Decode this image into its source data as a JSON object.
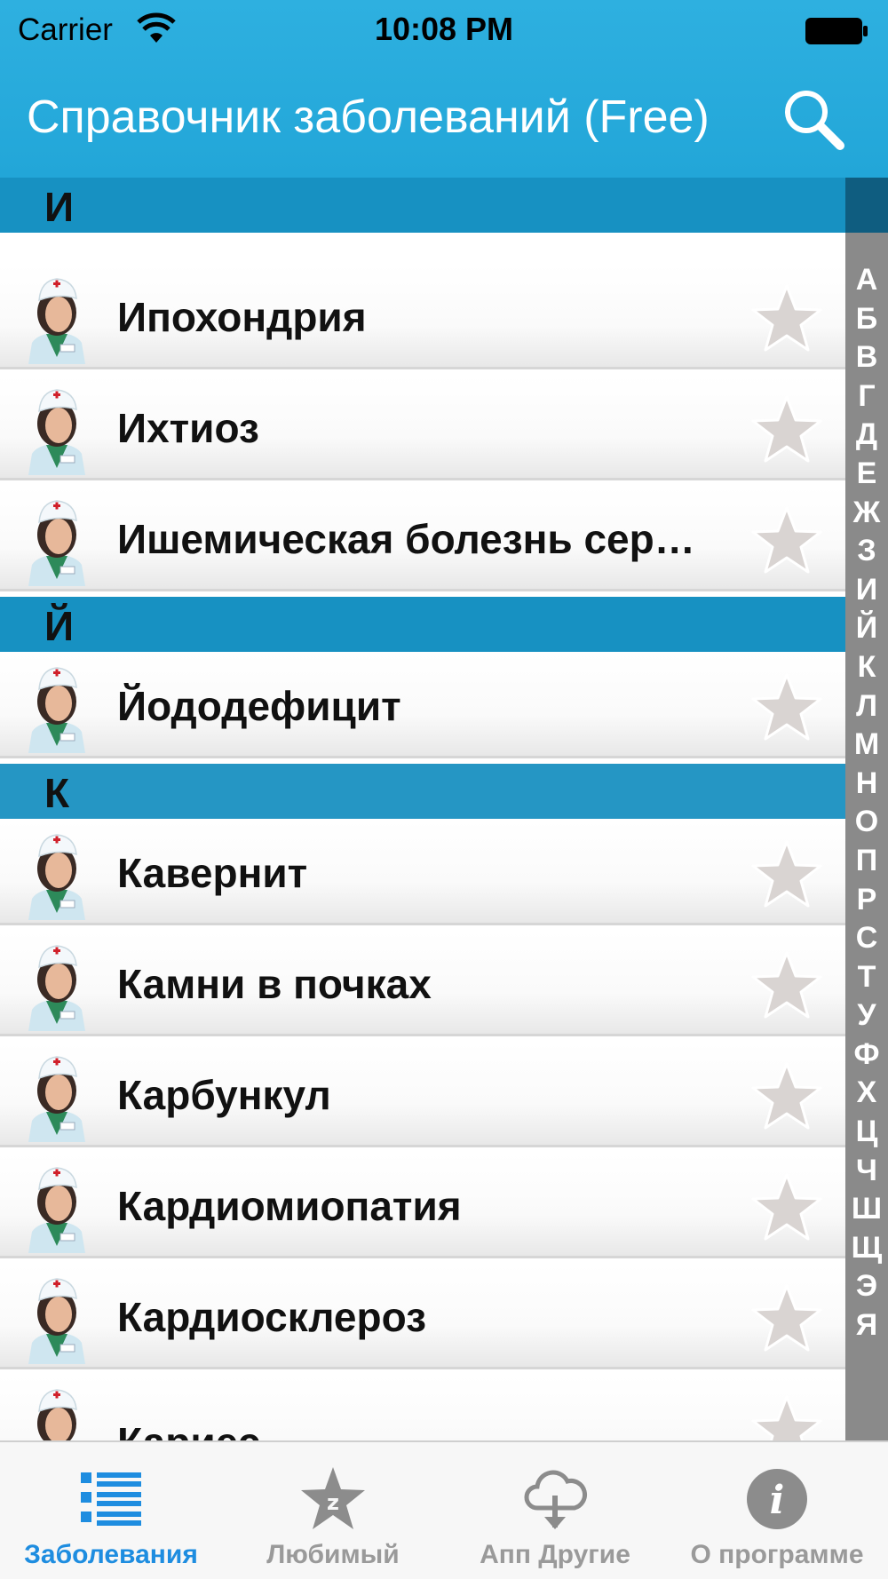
{
  "status_bar": {
    "carrier": "Carrier",
    "time": "10:08 PM"
  },
  "nav": {
    "title": "Справочник заболеваний (Free)",
    "search_icon": "search-icon"
  },
  "sections": [
    {
      "letter": "И",
      "items": [
        "Ипохондрия",
        "Ихтиоз",
        "Ишемическая болезнь сер…"
      ]
    },
    {
      "letter": "Й",
      "items": [
        "Йододефицит"
      ]
    },
    {
      "letter": "К",
      "items": [
        "Кавернит",
        "Камни в почках",
        "Карбункул",
        "Кардиомиопатия",
        "Кардиосклероз",
        "Кариес"
      ]
    }
  ],
  "index_letters": [
    "А",
    "Б",
    "В",
    "Г",
    "Д",
    "Е",
    "Ж",
    "З",
    "И",
    "Й",
    "К",
    "Л",
    "М",
    "Н",
    "О",
    "П",
    "Р",
    "С",
    "Т",
    "У",
    "Ф",
    "Х",
    "Ц",
    "Ч",
    "Ш",
    "Щ",
    "Э",
    "Я"
  ],
  "tabs": [
    {
      "label": "Заболевания",
      "icon": "list-icon",
      "active": true
    },
    {
      "label": "Любимый",
      "icon": "star-badge-icon",
      "active": false
    },
    {
      "label": "Апп Другие",
      "icon": "cloud-download-icon",
      "active": false
    },
    {
      "label": "О программе",
      "icon": "info-icon",
      "active": false
    }
  ],
  "colors": {
    "nav_bar": "#22a6d8",
    "section_header": "#1791c2",
    "index_bar": "#8a8a8a",
    "active_tab": "#1e8de0",
    "inactive_tab": "#9a9a9a"
  }
}
